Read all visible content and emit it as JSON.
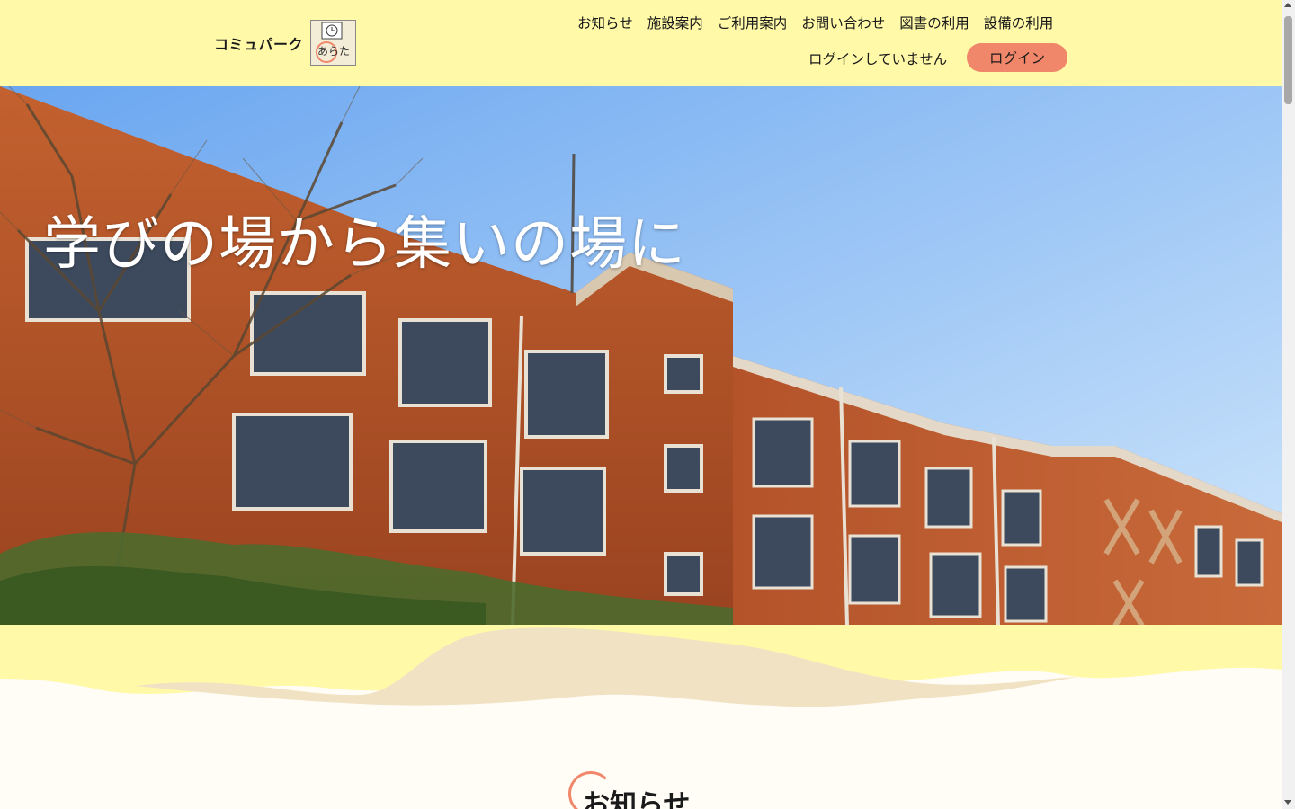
{
  "brand": {
    "name": "コミュパーク",
    "logo_text": "あらた"
  },
  "nav": {
    "items": [
      {
        "label": "お知らせ"
      },
      {
        "label": "施設案内"
      },
      {
        "label": "ご利用案内"
      },
      {
        "label": "お問い合わせ"
      },
      {
        "label": "図書の利用"
      },
      {
        "label": "設備の利用"
      }
    ],
    "login_status": "ログインしていません",
    "login_button": "ログイン"
  },
  "hero": {
    "title": "学びの場から集いの場に"
  },
  "section": {
    "news_title": "お知らせ"
  },
  "colors": {
    "header_bg": "#fff9a8",
    "accent": "#f0876a",
    "page_bg": "#fffdf5",
    "sky": "#7fb4f5",
    "brick": "#b8532a"
  }
}
